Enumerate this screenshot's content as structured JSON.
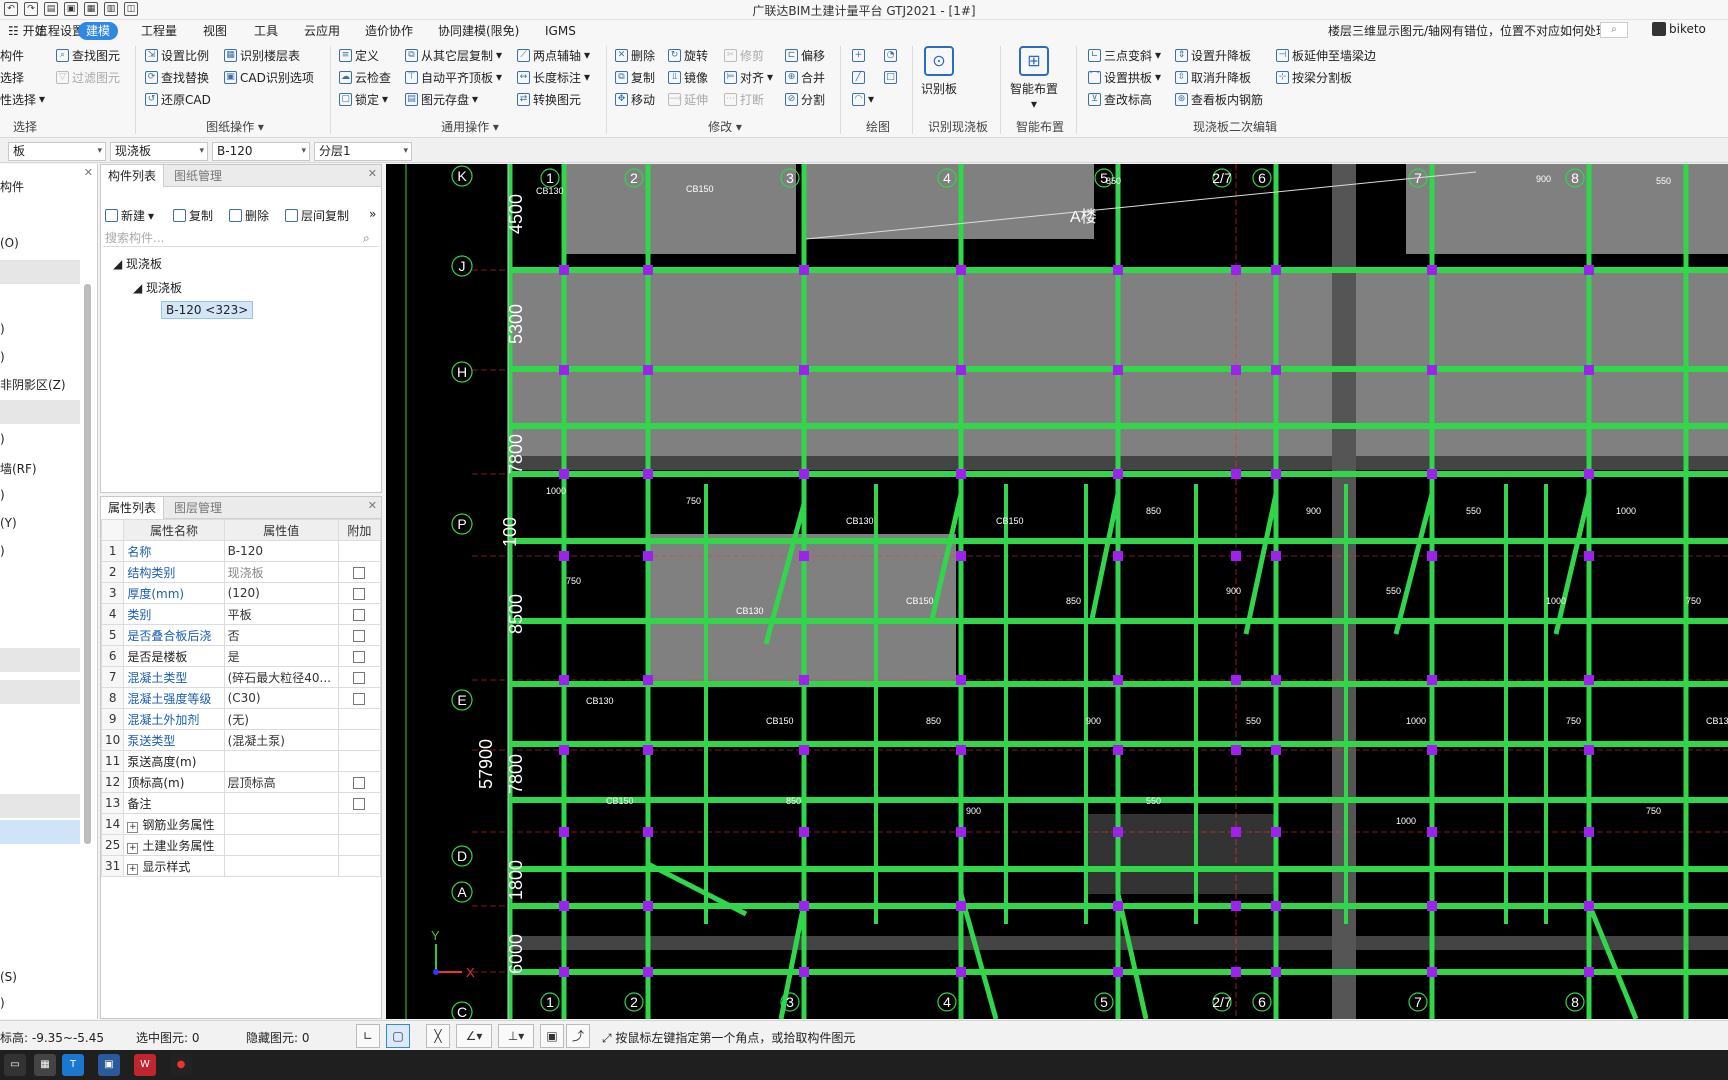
{
  "title": "广联达BIM土建计量平台 GTJ2021 - [1#]",
  "menu": [
    "☷ 开始",
    "工程设置",
    "建模",
    "工程量",
    "视图",
    "工具",
    "云应用",
    "造价协作",
    "协同建模(限免)",
    "IGMS"
  ],
  "menu_active": "建模",
  "help_text": "楼层三维显示图元/轴网有错位，位置不对应如何处理?",
  "user_name": "biketo",
  "ribbon": {
    "select": {
      "items": [
        "构件",
        "选择",
        "性选择",
        "查找图元",
        "过滤图元"
      ],
      "group": "选择"
    },
    "drawing_ops": {
      "items": [
        "设置比例",
        "识别楼层表",
        "查找替换",
        "CAD识别选项",
        "还原CAD"
      ],
      "group": "图纸操作"
    },
    "general_ops": {
      "items": [
        "定义",
        "从其它层复制",
        "两点辅轴",
        "云检查",
        "自动平齐顶板",
        "长度标注",
        "锁定",
        "图元存盘",
        "转换图元"
      ],
      "group": "通用操作"
    },
    "modify": {
      "items": [
        "删除",
        "旋转",
        "修剪",
        "偏移",
        "复制",
        "镜像",
        "对齐",
        "合并",
        "移动",
        "延伸",
        "打断",
        "分割"
      ],
      "group": "修改"
    },
    "draw": {
      "group": "绘图"
    },
    "recognize": {
      "label": "识别板",
      "group": "识别现浇板"
    },
    "smart": {
      "label": "智能布置",
      "group": "智能布置"
    },
    "slab_edit": {
      "items": [
        "三点变斜",
        "设置升降板",
        "板延伸至墙梁边",
        "设置拱板",
        "取消升降板",
        "按梁分割板",
        "查改标高",
        "查看板内钢筋"
      ],
      "group": "现浇板二次编辑"
    }
  },
  "selectors": [
    "板",
    "现浇板",
    "B-120",
    "分层1"
  ],
  "left_nav": [
    "构件",
    "(O)",
    ")",
    ")",
    "非阴影区(Z)",
    ")",
    "墙(RF)",
    ")",
    "(Y)",
    ")",
    "(S)",
    ")"
  ],
  "component_panel": {
    "tabs": [
      "构件列表",
      "图纸管理"
    ],
    "tools": [
      "新建",
      "复制",
      "删除",
      "层间复制"
    ],
    "search_placeholder": "搜索构件...",
    "tree": [
      "现浇板",
      "现浇板",
      "B-120 <323>"
    ]
  },
  "property_panel": {
    "tabs": [
      "属性列表",
      "图层管理"
    ],
    "headers": [
      "属性名称",
      "属性值",
      "附加"
    ],
    "rows": [
      {
        "n": "1",
        "k": "名称",
        "v": "B-120",
        "blue": true,
        "chk": false
      },
      {
        "n": "2",
        "k": "结构类别",
        "v": "现浇板",
        "blue": true,
        "chk": true,
        "gray": true
      },
      {
        "n": "3",
        "k": "厚度(mm)",
        "v": "(120)",
        "blue": true,
        "chk": true
      },
      {
        "n": "4",
        "k": "类别",
        "v": "平板",
        "blue": true,
        "chk": true
      },
      {
        "n": "5",
        "k": "是否叠合板后浇",
        "v": "否",
        "blue": true,
        "chk": true
      },
      {
        "n": "6",
        "k": "是否是楼板",
        "v": "是",
        "blue": false,
        "chk": true
      },
      {
        "n": "7",
        "k": "混凝土类型",
        "v": "(碎石最大粒径40...",
        "blue": true,
        "chk": true
      },
      {
        "n": "8",
        "k": "混凝土强度等级",
        "v": "(C30)",
        "blue": true,
        "chk": true
      },
      {
        "n": "9",
        "k": "混凝土外加剂",
        "v": "(无)",
        "blue": true,
        "chk": false
      },
      {
        "n": "10",
        "k": "泵送类型",
        "v": "(混凝土泵)",
        "blue": true,
        "chk": false
      },
      {
        "n": "11",
        "k": "泵送高度(m)",
        "v": "",
        "blue": false,
        "chk": false
      },
      {
        "n": "12",
        "k": "顶标高(m)",
        "v": "层顶标高",
        "blue": false,
        "chk": true
      },
      {
        "n": "13",
        "k": "备注",
        "v": "",
        "blue": false,
        "chk": true
      },
      {
        "n": "14",
        "k": "钢筋业务属性",
        "v": "",
        "blue": false,
        "chk": false,
        "plus": true
      },
      {
        "n": "25",
        "k": "土建业务属性",
        "v": "",
        "blue": false,
        "chk": false,
        "plus": true
      },
      {
        "n": "31",
        "k": "显示样式",
        "v": "",
        "blue": false,
        "chk": false,
        "plus": true
      }
    ]
  },
  "canvas": {
    "axis_top": [
      "1",
      "2",
      "3",
      "4",
      "5",
      "2/7",
      "6",
      "7",
      "8"
    ],
    "axis_left": [
      "K",
      "J",
      "H",
      "P",
      "E",
      "D",
      "A",
      "C"
    ],
    "dims_left": [
      "4500",
      "5300",
      "7800",
      "8500",
      "7800",
      "1800",
      "6000",
      "57900",
      "100"
    ],
    "slab_labels": [
      "CB130",
      "CB150",
      "850",
      "900",
      "550",
      "1000",
      "750"
    ],
    "annotation": "A楼",
    "axis_x": "X",
    "axis_y": "Y"
  },
  "status": {
    "elevation": "标高:  -9.35~-5.45",
    "selected": "选中图元: 0",
    "hidden": "隐藏图元: 0",
    "hint": "按鼠标左键指定第一个角点，或拾取构件图元"
  },
  "colors": {
    "beam": "#31d64a",
    "slab": "#808080",
    "column": "#a020f0",
    "axis": "#ff3030",
    "accent": "#2f88e6"
  }
}
